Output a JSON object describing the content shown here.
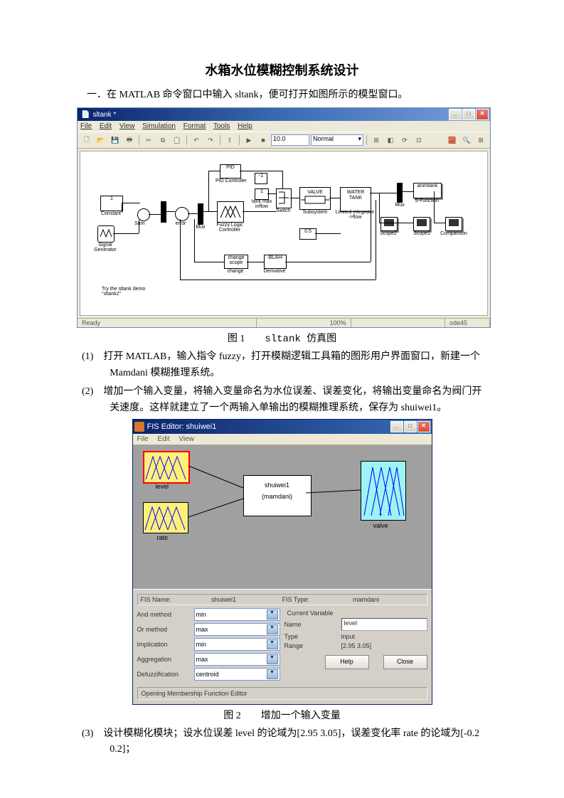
{
  "doc": {
    "title": "水箱水位模糊控制系统设计",
    "s1": "一．在 MATLAB 命令窗口中输入 sltank，便可打开如图所示的模型窗口。",
    "cap1_a": "图 1",
    "cap1_b": "sltank 仿真图",
    "li1": "(1)　打开 MATLAB，输入指令 fuzzy，打开模糊逻辑工具箱的图形用户界面窗口，新建一个 Mamdani 模糊推理系统。",
    "li2": "(2)　增加一个输入变量，将输入变量命名为水位误差、误差变化，将输出变量命名为阀门开关速度。这样就建立了一个两输入单输出的模糊推理系统，保存为 shuiwei1。",
    "cap2_a": "图 2",
    "cap2_b": "增加一个输入变量",
    "li3": "(3)　设计模糊化模块；设水位误差 level 的论域为[2.95 3.05]，误差变化率 rate 的论域为[-0.2 0.2]；"
  },
  "sim": {
    "wintitle": "sltank *",
    "menus": [
      "File",
      "Edit",
      "View",
      "Simulation",
      "Format",
      "Tools",
      "Help"
    ],
    "stop": "10.0",
    "solver": "Normal",
    "blocks": {
      "constant": "Constant",
      "sum": "Sum",
      "mux": "Mux",
      "siggen": "Signal\\nGenerator",
      "pid": "PID",
      "pidlbl": "PID Controller",
      "valve": "VALVE",
      "subsys": "Subsystem",
      "water": "WATER\\nTANK",
      "mux2": "Mux",
      "animtank": "animtank",
      "sfunc": "S-Function",
      "scope": "Scope1",
      "scope2": "Scope2",
      "compare": "Comparison",
      "fuzzy": "Fuzzy Logic\\nController",
      "dudt": "change",
      "dudt2": "change",
      "blah": "-BLAH-",
      "deriv": "Derivative",
      "limintg": "Limited Integrator\\n->flow",
      "const1": "-1",
      "tankmax": "tank max\\ninflow",
      "tankdemo": "Try the sltank demo\\n\"sltank2\"",
      "one": "1",
      "p5": "0.5"
    },
    "status": {
      "ready": "Ready",
      "pct": "100%",
      "ode": "ode45"
    }
  },
  "fis": {
    "title": "FIS Editor: shuiwei1",
    "menus": [
      "File",
      "Edit",
      "View"
    ],
    "in1": "level",
    "in2": "rate",
    "sys": "shuiwei1",
    "systype": "(mamdani)",
    "out": "valve",
    "row1": {
      "a": "FIS Name:",
      "b": "shuiwei1",
      "c": "FIS Type:",
      "d": "mamdani"
    },
    "and": "And method",
    "andv": "min",
    "or": "Or method",
    "orv": "max",
    "imp": "Implication",
    "impv": "min",
    "agg": "Aggregation",
    "aggv": "max",
    "def": "Defuzzification",
    "defv": "centroid",
    "cv": "Current Variable",
    "name": "Name",
    "namev": "level",
    "type": "Type",
    "typev": "input",
    "range": "Range",
    "rangev": "[2.95 3.05]",
    "help": "Help",
    "close": "Close",
    "status": "Opening Membership Function Editor"
  }
}
